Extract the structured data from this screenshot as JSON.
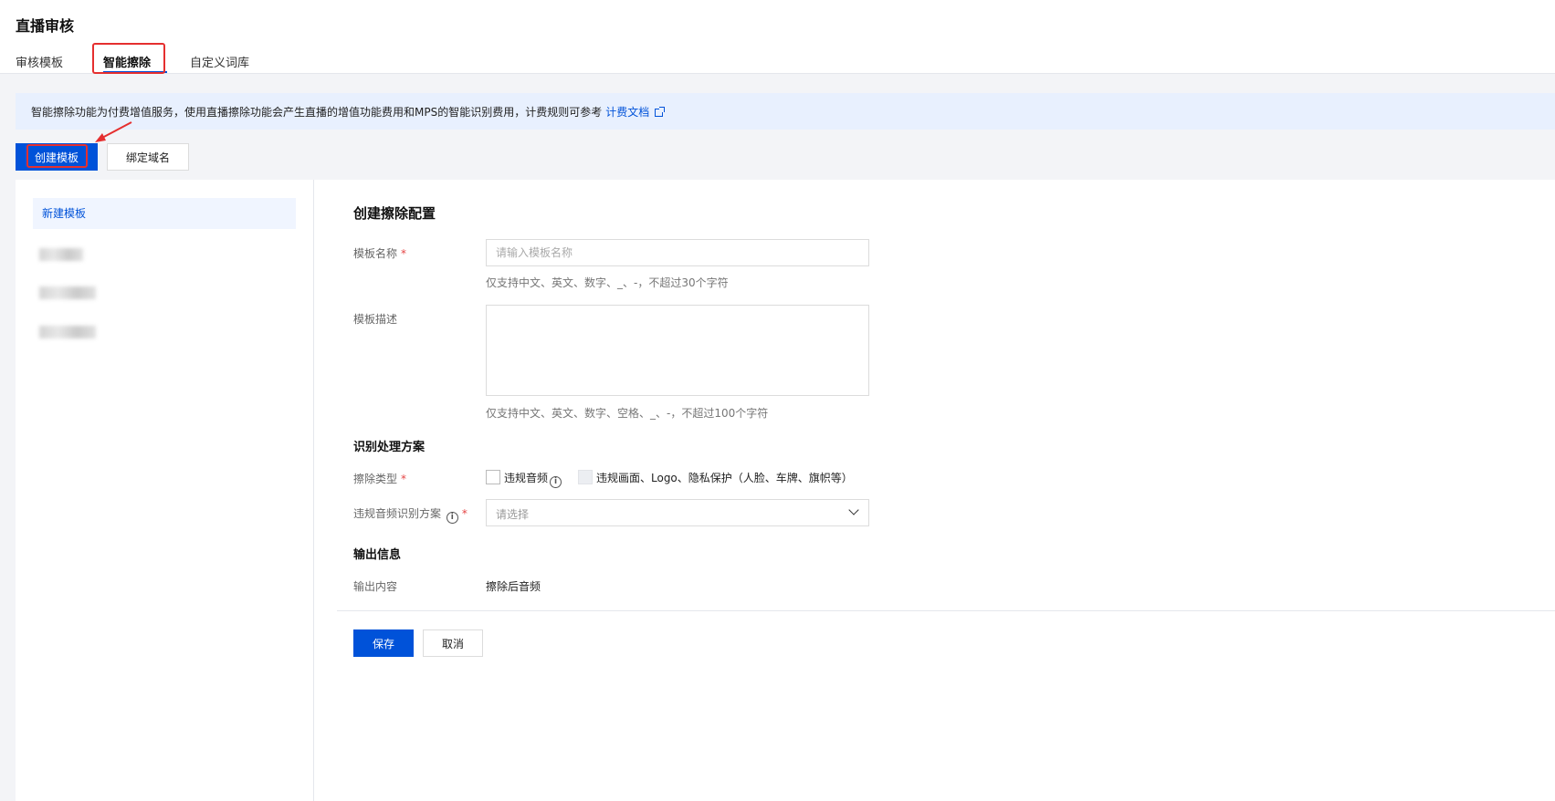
{
  "header": {
    "title": "直播审核",
    "tabs": [
      {
        "label": "审核模板"
      },
      {
        "label": "智能擦除"
      },
      {
        "label": "自定义词库"
      }
    ]
  },
  "notice": {
    "text": "智能擦除功能为付费增值服务，使用直播擦除功能会产生直播的增值功能费用和MPS的智能识别费用，计费规则可参考",
    "link": "计费文档"
  },
  "toolbar": {
    "create_template": "创建模板",
    "bind_domain": "绑定域名"
  },
  "sidebar": {
    "active_item": "新建模板"
  },
  "form": {
    "title": "创建擦除配置",
    "name_label": "模板名称",
    "name_placeholder": "请输入模板名称",
    "name_hint": "仅支持中文、英文、数字、_、-，不超过30个字符",
    "desc_label": "模板描述",
    "desc_hint": "仅支持中文、英文、数字、空格、_、-，不超过100个字符",
    "recognition_section": "识别处理方案",
    "erase_type_label": "擦除类型",
    "erase_option_audio": "违规音频",
    "erase_option_visual": "违规画面、Logo、隐私保护（人脸、车牌、旗帜等）",
    "audio_scheme_label": "违规音频识别方案",
    "audio_scheme_placeholder": "请选择",
    "output_section": "输出信息",
    "output_content_label": "输出内容",
    "output_content_value": "擦除后音频",
    "required_mark": "*",
    "info_glyph": "i",
    "save": "保存",
    "cancel": "取消"
  },
  "colors": {
    "primary": "#0052d9",
    "highlight_box": "#e52f2f",
    "notice_bg": "#e8f0fe"
  }
}
